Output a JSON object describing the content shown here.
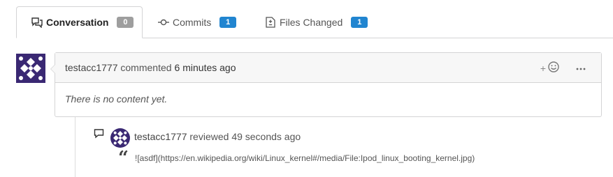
{
  "tabs": [
    {
      "label": "Conversation",
      "count": "0",
      "icon": "conversation-icon",
      "active": true
    },
    {
      "label": "Commits",
      "count": "1",
      "icon": "commit-icon",
      "active": false
    },
    {
      "label": "Files Changed",
      "count": "1",
      "icon": "file-diff-icon",
      "active": false
    }
  ],
  "comment": {
    "author": "testacc1777",
    "action": "commented",
    "time": "6 minutes ago",
    "body": "There is no content yet.",
    "add_label": "+",
    "actions_icons": [
      "add-reaction-icon",
      "more-options-icon"
    ]
  },
  "review": {
    "author": "testacc1777",
    "action": "reviewed",
    "time": "49 seconds ago",
    "quote_mark": "“",
    "quote": "![asdf](https://en.wikipedia.org/wiki/Linux_kernel#/media/File:Ipod_linux_booting_kernel.jpg)"
  },
  "colors": {
    "count_grey": "#9e9e9e",
    "count_blue": "#2185d0",
    "avatar_primary": "#3a2873"
  }
}
